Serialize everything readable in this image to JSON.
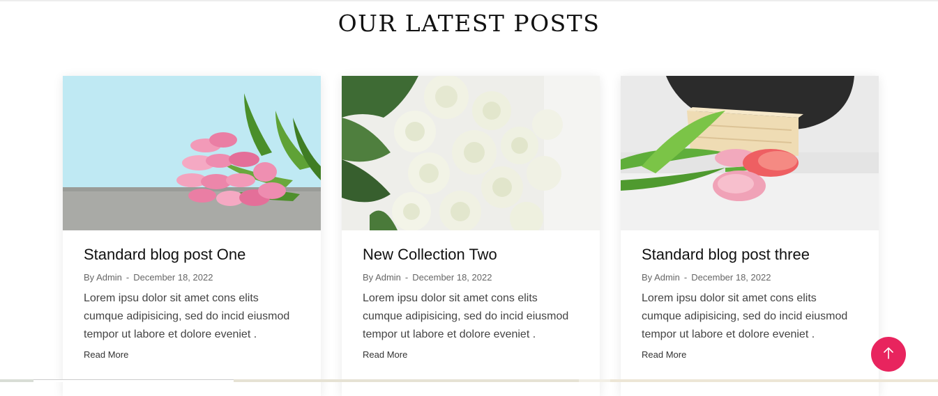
{
  "section": {
    "title": "OUR LATEST POSTS"
  },
  "posts": [
    {
      "title": "Standard blog post One",
      "author": "By Admin",
      "separator": "-",
      "date": "December 18, 2022",
      "excerpt": "Lorem ipsu dolor sit amet cons elits cumque adipisicing, sed do incid eiusmod tempor ut labore et dolore eveniet .",
      "read_more": "Read More",
      "image": "pink-tulips-bouquet"
    },
    {
      "title": "New Collection Two",
      "author": "By Admin",
      "separator": "-",
      "date": "December 18, 2022",
      "excerpt": "Lorem ipsu dolor sit amet cons elits cumque adipisicing, sed do incid eiusmod tempor ut labore et dolore eveniet .",
      "read_more": "Read More",
      "image": "white-roses-bouquet"
    },
    {
      "title": "Standard blog post three",
      "author": "By Admin",
      "separator": "-",
      "date": "December 18, 2022",
      "excerpt": "Lorem ipsu dolor sit amet cons elits cumque adipisicing, sed do incid eiusmod tempor ut labore et dolore eveniet .",
      "read_more": "Read More",
      "image": "tulips-on-table"
    }
  ],
  "scroll_top": {
    "icon": "arrow-up-icon"
  },
  "colors": {
    "accent": "#e8245e",
    "title": "#111111",
    "meta": "#666666",
    "text": "#444444"
  }
}
